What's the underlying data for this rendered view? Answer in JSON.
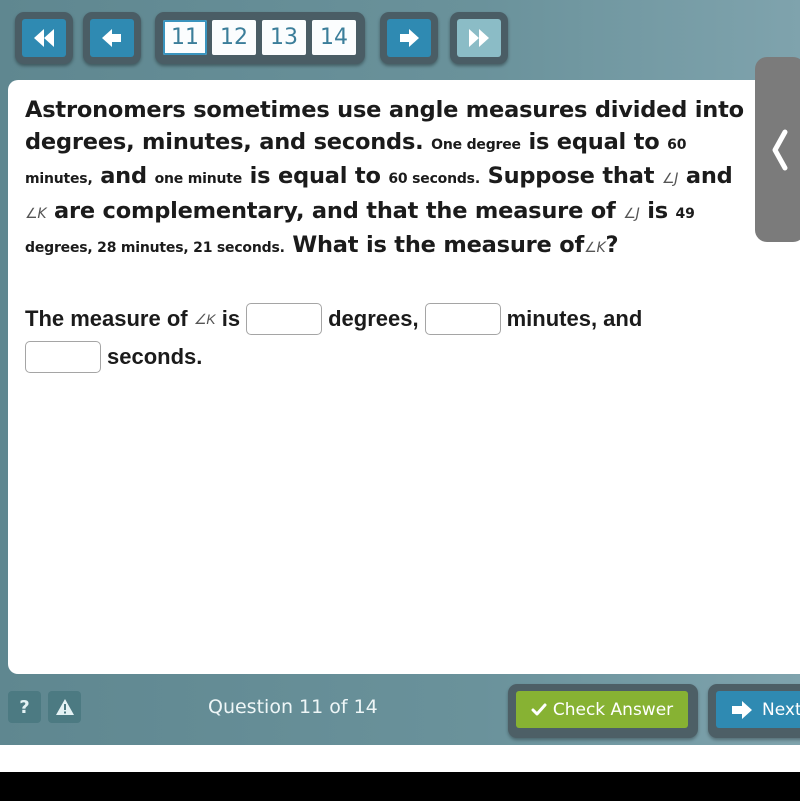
{
  "nav": {
    "first_label": "First question",
    "prev_label": "Previous question",
    "next_label": "Next question",
    "last_label": "Last question",
    "pages": [
      {
        "label": "11",
        "current": true
      },
      {
        "label": "12",
        "current": false
      },
      {
        "label": "13",
        "current": false
      },
      {
        "label": "14",
        "current": false
      }
    ]
  },
  "question": {
    "intro": "Astronomers sometimes use angle measures divided into degrees, minutes, and seconds.",
    "one_degree": "One degree",
    "is_equal_to_1": "is equal to",
    "sixty_minutes": "60 minutes,",
    "and_1": "and",
    "one_minute": "one minute",
    "is_equal_to_2": "is equal to",
    "sixty_seconds": "60 seconds.",
    "suppose": "Suppose that",
    "angle_j": "∠J",
    "and_2": "and",
    "angle_k": "∠K",
    "are_comp": "are complementary, and that the measure of",
    "is": "is",
    "measure_j": "49 degrees, 28 minutes, 21 seconds.",
    "what_is": "What is the measure of",
    "qmark": "?"
  },
  "answer": {
    "prefix": "The measure of",
    "angle_k": "∠K",
    "is": "is",
    "degrees_label": "degrees,",
    "minutes_label": "minutes, and",
    "seconds_label": "seconds.",
    "degrees_value": "",
    "minutes_value": "",
    "seconds_value": ""
  },
  "side_tab": {
    "icon": "chevron-left-icon"
  },
  "footer": {
    "help_label": "?",
    "counter": "Question 11 of 14",
    "check_answer": "Check Answer",
    "next": "Next"
  },
  "colors": {
    "background": "#6a929b",
    "nav_button": "#2f8ab2",
    "check_button": "#87b233",
    "next_button": "#2f8ab2",
    "page_number_text": "#3b7e9a"
  }
}
